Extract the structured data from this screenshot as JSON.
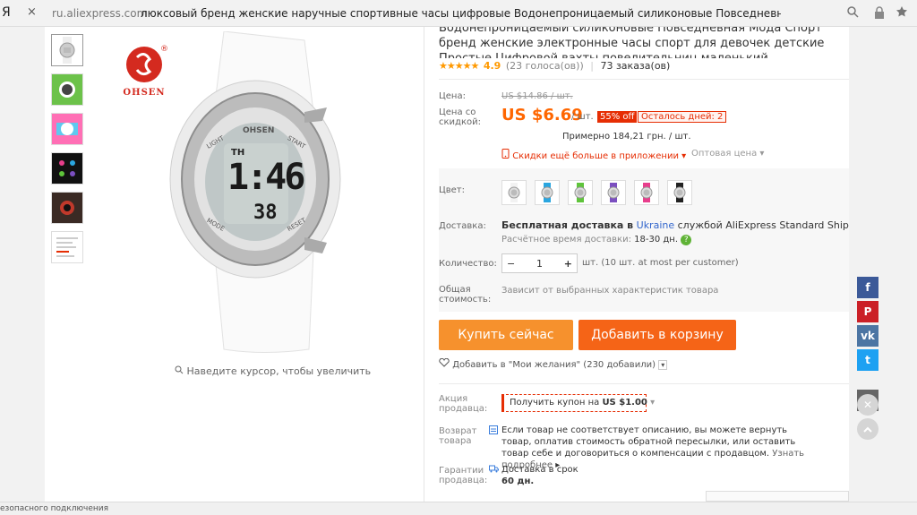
{
  "browser": {
    "ya_letter": "Я",
    "close_glyph": "×",
    "domain": "ru.aliexpress.com",
    "tab_title": "люксовый бренд женские наручные спортивные часы цифровые Водонепроницаемый силиконовые Повседневная Мода Спорт…",
    "status_text": "езопасного подключения"
  },
  "gallery": {
    "logo_text": "OHSEN",
    "watch_face": {
      "light": "LIGHT",
      "start": "START",
      "mode": "MODE",
      "reset": "RESET",
      "th": "TH",
      "time": "1:46",
      "seconds": "38",
      "bezel_brand": "OHSEN"
    },
    "zoom_hint": "Наведите курсор, чтобы увеличить"
  },
  "product": {
    "title": "Водонепроницаемый силиконовые Повседневная Мода Спорт бренд женские электронные часы спорт для девочек детские Простые Цифровой вахты повелительниц маленький секундомер",
    "stars": "★★★★★",
    "score": "4.9",
    "votes": "(23 голоса(ов))",
    "orders": "73 заказа(ов)"
  },
  "price": {
    "label": "Цена:",
    "old": "US $14.86 / шт.",
    "discount_label": "Цена со скидкой:",
    "new": "US $6.69",
    "unit": "/ шт.",
    "off": "55% off",
    "days_left": "Осталось дней: 2",
    "approx": "Примерно 184,21 грн. / шт.",
    "app_discount": "Скидки ещё больше в приложении",
    "wholesale": "Оптовая цена"
  },
  "options": {
    "color_label": "Цвет:",
    "colors": [
      "#f2f2f2",
      "#2aa6e0",
      "#5fc43b",
      "#7b4fc0",
      "#e83e8c",
      "#222222"
    ],
    "delivery_label": "Доставка:",
    "delivery_free": "Бесплатная доставка в",
    "delivery_country": "Ukraine",
    "delivery_via": "службой AliExpress Standard Shipping",
    "delivery_time_label": "Расчётное время доставки:",
    "delivery_time": "18-30 дн.",
    "qty_label": "Количество:",
    "qty_value": "1",
    "qty_minus": "−",
    "qty_plus": "+",
    "qty_note": "шт. (10 шт. at most per customer)",
    "total_label": "Общая стоимость:",
    "total_value": "Зависит от выбранных характеристик товара"
  },
  "actions": {
    "buy_now": "Купить сейчас",
    "add_cart": "Добавить в корзину",
    "wish": "Добавить в \"Мои желания\" (230 добавили)"
  },
  "promo": {
    "seller_label": "Акция продавца:",
    "coupon": "Получить купон на",
    "coupon_amount": "US $1.00",
    "return_label": "Возврат товара",
    "return_text": "Если товар не соответствует описанию, вы можете вернуть товар, оплатив стоимость обратной пересылки, или оставить товар себе и договориться о компенсации с продавцом.",
    "return_more": "Узнать подробнее",
    "guarantee_label": "Гарантии продавца:",
    "guarantee_text": "Доставка в срок",
    "guarantee_days": "60 дн."
  },
  "social": {
    "items": [
      {
        "glyph": "f",
        "color": "#3b5998"
      },
      {
        "glyph": "P",
        "color": "#cb2027"
      },
      {
        "glyph": "vk",
        "color": "#4c75a3"
      },
      {
        "glyph": "t",
        "color": "#1da1f2"
      },
      {
        "glyph": "✎",
        "color": "#666666"
      }
    ]
  }
}
